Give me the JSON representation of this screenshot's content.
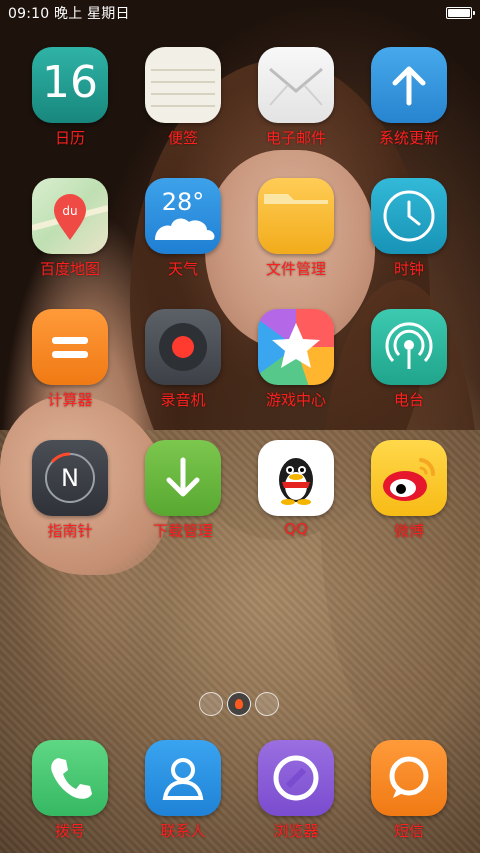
{
  "status_bar": {
    "time_text": "09:10 晚上 星期日",
    "battery_level": 1.0
  },
  "apps": [
    {
      "id": "calendar",
      "label": "日历",
      "icon": "calendar-icon",
      "icon_text": "16"
    },
    {
      "id": "memo",
      "label": "便签",
      "icon": "memo-icon"
    },
    {
      "id": "email",
      "label": "电子邮件",
      "icon": "mail-icon"
    },
    {
      "id": "update",
      "label": "系统更新",
      "icon": "arrow-up-icon"
    },
    {
      "id": "baidu-map",
      "label": "百度地图",
      "icon": "map-pin-icon",
      "icon_text": "du"
    },
    {
      "id": "weather",
      "label": "天气",
      "icon": "cloud-icon",
      "icon_text": "28°"
    },
    {
      "id": "file-manager",
      "label": "文件管理",
      "icon": "folder-icon"
    },
    {
      "id": "clock",
      "label": "时钟",
      "icon": "clock-icon"
    },
    {
      "id": "calculator",
      "label": "计算器",
      "icon": "equals-icon"
    },
    {
      "id": "recorder",
      "label": "录音机",
      "icon": "record-icon"
    },
    {
      "id": "game-center",
      "label": "游戏中心",
      "icon": "star-icon"
    },
    {
      "id": "radio",
      "label": "电台",
      "icon": "radio-icon"
    },
    {
      "id": "compass",
      "label": "指南针",
      "icon": "compass-icon",
      "icon_text": "N"
    },
    {
      "id": "download-manager",
      "label": "下载管理",
      "icon": "arrow-down-icon"
    },
    {
      "id": "qq",
      "label": "QQ",
      "icon": "penguin-icon"
    },
    {
      "id": "weibo",
      "label": "微博",
      "icon": "weibo-icon"
    }
  ],
  "page_indicator": {
    "page_count": 3,
    "current_page": 2
  },
  "dock": [
    {
      "id": "phone",
      "label": "拨号",
      "icon": "phone-icon"
    },
    {
      "id": "contacts",
      "label": "联系人",
      "icon": "person-icon"
    },
    {
      "id": "browser",
      "label": "浏览器",
      "icon": "browser-icon"
    },
    {
      "id": "sms",
      "label": "短信",
      "icon": "chat-bubble-icon"
    }
  ],
  "colors": {
    "label_color": "#ff1f1f",
    "status_text": "#ffffff"
  }
}
